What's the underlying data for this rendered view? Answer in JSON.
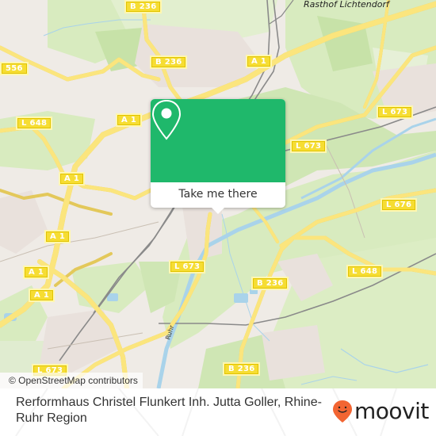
{
  "map": {
    "place_labels": [
      {
        "name": "Rasthof Lichtendorf"
      }
    ],
    "river_label": "Ruhr",
    "road_shields": [
      {
        "label": "B 236"
      },
      {
        "label": "556"
      },
      {
        "label": "B 236"
      },
      {
        "label": "A 1"
      },
      {
        "label": "L 648"
      },
      {
        "label": "A 1"
      },
      {
        "label": "L 673"
      },
      {
        "label": "L 673"
      },
      {
        "label": "A 1"
      },
      {
        "label": "L 676"
      },
      {
        "label": "A 1"
      },
      {
        "label": "A 1"
      },
      {
        "label": "A 1"
      },
      {
        "label": "L 673"
      },
      {
        "label": "B 236"
      },
      {
        "label": "L 648"
      },
      {
        "label": "B 236"
      },
      {
        "label": "L 673"
      }
    ],
    "attribution": "© OpenStreetMap contributors"
  },
  "popup": {
    "icon": "map-pin-icon",
    "button_label": "Take me there",
    "accent_color": "#1fb86b"
  },
  "footer": {
    "title": "Rerformhaus Christel Flunkert Inh. Jutta Goller, Rhine-Ruhr Region",
    "brand": "moovit",
    "brand_icon": "moovit-smiley-pin-icon",
    "brand_color": "#f26532"
  }
}
